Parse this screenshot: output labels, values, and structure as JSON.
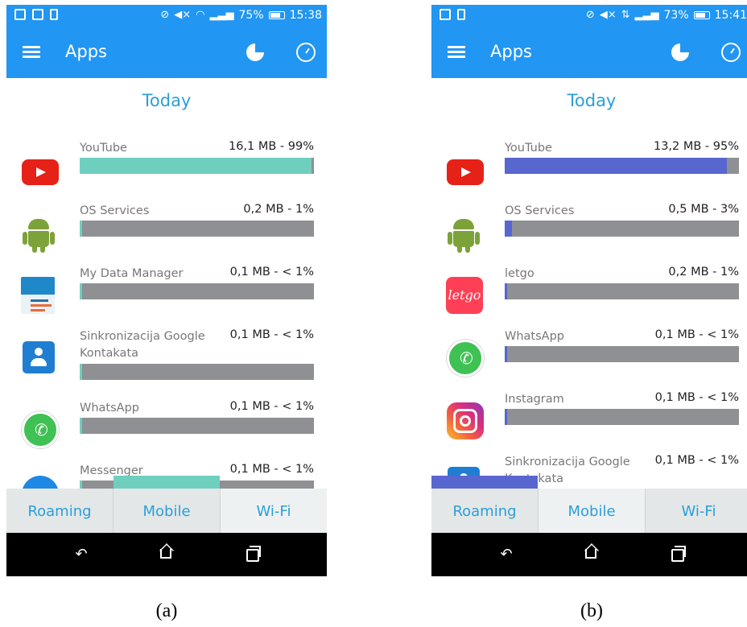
{
  "phones": [
    {
      "status_time": "15:38",
      "status_battery": "75%",
      "app_title": "Apps",
      "period": "Today",
      "accent": "#6fcfbf",
      "apps": [
        {
          "name": "YouTube",
          "usage": "16,1 MB - 99%",
          "percent": 99,
          "icon": "youtube-icon"
        },
        {
          "name": "OS Services",
          "usage": "0,2 MB - 1%",
          "percent": 1,
          "icon": "android-icon"
        },
        {
          "name": "My Data Manager",
          "usage": "0,1 MB - < 1%",
          "percent": 0.5,
          "icon": "my-data-manager-icon"
        },
        {
          "name": "Sinkronizacija Google Kontakata",
          "usage": "0,1 MB - < 1%",
          "percent": 0.5,
          "icon": "contacts-icon"
        },
        {
          "name": "WhatsApp",
          "usage": "0,1 MB - < 1%",
          "percent": 0.5,
          "icon": "whatsapp-icon"
        },
        {
          "name": "Messenger",
          "usage": "0,1 MB - < 1%",
          "percent": 0.5,
          "icon": "messenger-icon"
        }
      ],
      "tabs": [
        "Mobile",
        "Wi-Fi",
        "Roaming"
      ],
      "active_tab": "Wi-Fi",
      "caption": "(a)"
    },
    {
      "status_time": "15:41",
      "status_battery": "73%",
      "app_title": "Apps",
      "period": "Today",
      "accent": "#5866cf",
      "apps": [
        {
          "name": "YouTube",
          "usage": "13,2 MB - 95%",
          "percent": 95,
          "icon": "youtube-icon"
        },
        {
          "name": "OS Services",
          "usage": "0,5 MB - 3%",
          "percent": 3,
          "icon": "android-icon"
        },
        {
          "name": "letgo",
          "usage": "0,2 MB - 1%",
          "percent": 1,
          "icon": "letgo-icon"
        },
        {
          "name": "WhatsApp",
          "usage": "0,1 MB - < 1%",
          "percent": 0.5,
          "icon": "whatsapp-icon"
        },
        {
          "name": "Instagram",
          "usage": "0,1 MB - < 1%",
          "percent": 0.5,
          "icon": "instagram-icon"
        },
        {
          "name": "Sinkronizacija Google Kontakata",
          "usage": "0,1 MB - < 1%",
          "percent": 0.5,
          "icon": "contacts-icon"
        }
      ],
      "tabs": [
        "Mobile",
        "Wi-Fi",
        "Roaming"
      ],
      "active_tab": "Mobile",
      "caption": "(b)"
    }
  ],
  "icons": {
    "back": "back-icon",
    "home": "home-icon",
    "recents": "recents-icon",
    "menu": "menu-icon",
    "pie": "pie-chart-icon",
    "history": "clock-icon"
  },
  "letgo_logo_text": "letgo"
}
